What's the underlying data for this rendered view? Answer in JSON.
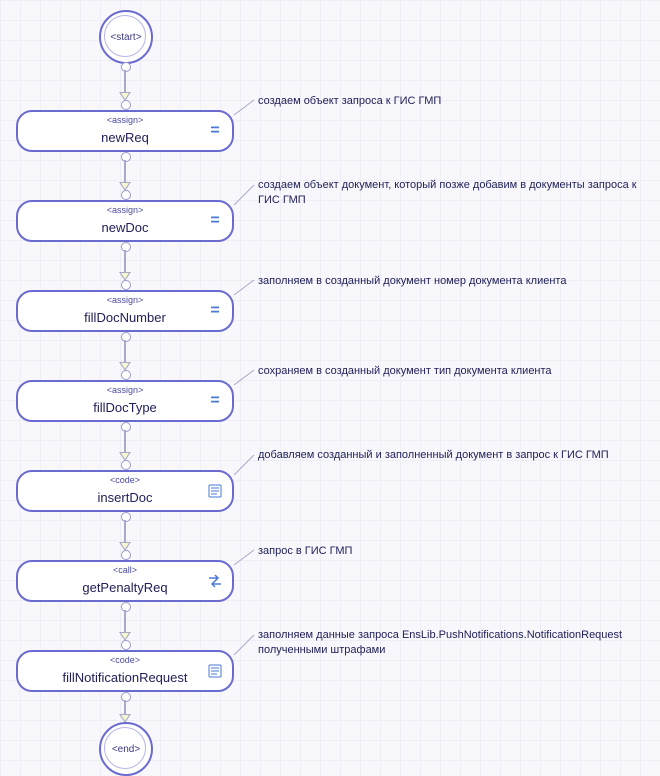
{
  "start": {
    "label": "<start>"
  },
  "end": {
    "label": "<end>"
  },
  "nodes": [
    {
      "type": "<assign>",
      "name": "newReq",
      "annotation": "создаем объект запроса к ГИС ГМП",
      "icon": "assign"
    },
    {
      "type": "<assign>",
      "name": "newDoc",
      "annotation": "создаем объект документ, который позже добавим в документы запроса к ГИС ГМП",
      "icon": "assign"
    },
    {
      "type": "<assign>",
      "name": "fillDocNumber",
      "annotation": "заполняем в созданный документ номер документа клиента",
      "icon": "assign"
    },
    {
      "type": "<assign>",
      "name": "fillDocType",
      "annotation": "сохраняем в созданный документ тип документа клиента",
      "icon": "assign"
    },
    {
      "type": "<code>",
      "name": "insertDoc",
      "annotation": "добавляем созданный и заполненный документ в запрос к ГИС ГМП",
      "icon": "code"
    },
    {
      "type": "<call>",
      "name": "getPenaltyReq",
      "annotation": "запрос в ГИС ГМП",
      "icon": "call"
    },
    {
      "type": "<code>",
      "name": "fillNotificationRequest",
      "annotation": "заполняем данные запроса EnsLib.PushNotifications.NotificationRequest полученными штрафами",
      "icon": "code"
    }
  ]
}
